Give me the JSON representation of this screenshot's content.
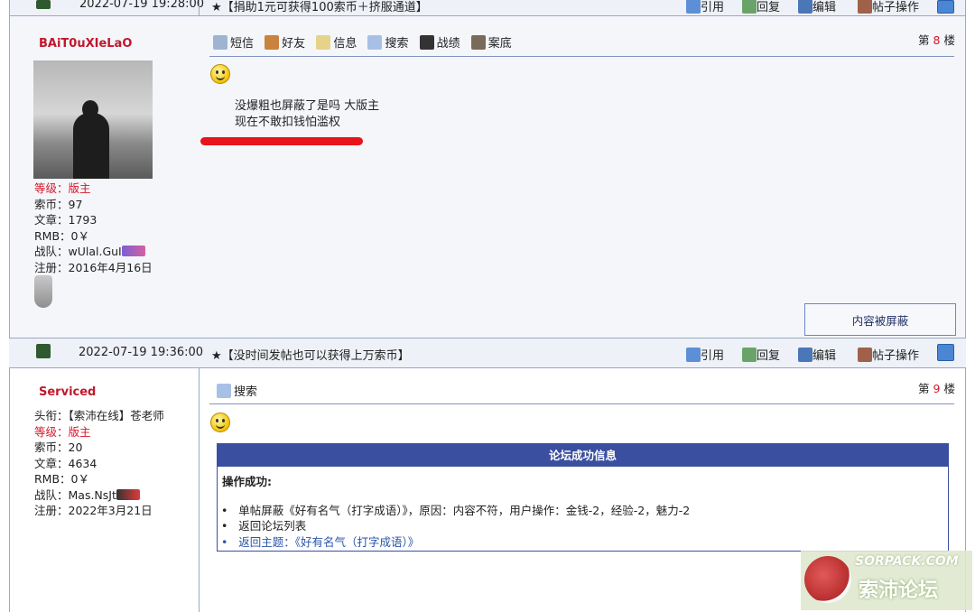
{
  "post_top": {
    "datetime": "2022-07-19 19:28:00",
    "title": "★【捐助1元可获得100索币＋挤服通道】",
    "actions": [
      "引用",
      "回复",
      "编辑",
      "帖子操作"
    ]
  },
  "post8": {
    "username": "BAiT0uXIeLaO",
    "info": {
      "level_label": "等级：",
      "level_value": "版主",
      "coins": "索币：97",
      "articles": "文章：1793",
      "rmb": "RMB：0￥",
      "team": "战队：wUlal.GuI",
      "registered": "注册：2016年4月16日"
    },
    "tools": [
      "短信",
      "好友",
      "信息",
      "搜索",
      "战绩",
      "案底"
    ],
    "floor_prefix": "第",
    "floor_num": "8",
    "floor_suffix": "楼",
    "content_line1": "没爆粗也屏蔽了是吗 大版主",
    "content_line2": "现在不敢扣钱怕滥权",
    "blocked_label": "内容被屏蔽"
  },
  "post9_bar": {
    "datetime": "2022-07-19 19:36:00",
    "title": "★【没时间发帖也可以获得上万索币】",
    "actions": [
      "引用",
      "回复",
      "编辑",
      "帖子操作"
    ]
  },
  "post9": {
    "username": "Serviced",
    "info": {
      "title_line": "头衔：【索沛在线】苍老师",
      "level_label": "等级：",
      "level_value": "版主",
      "coins": "索币：20",
      "articles": "文章：4634",
      "rmb": "RMB：0￥",
      "team": "战队：Mas.NsJt",
      "registered": "注册：2022年3月21日"
    },
    "tools": [
      "搜索"
    ],
    "floor_prefix": "第",
    "floor_num": "9",
    "floor_suffix": "楼",
    "message_box": {
      "header": "论坛成功信息",
      "status": "操作成功:",
      "items": [
        "单帖屏蔽《好有名气（打字成语）》，原因：内容不符，用户操作：金钱-2，经验-2，魅力-2",
        "返回论坛列表",
        "返回主题：《好有名气（打字成语）》"
      ]
    }
  },
  "watermark": {
    "top": "SORPACK.COM",
    "bottom": "索沛论坛"
  },
  "colors": {
    "bar_bg": "#eef1f7",
    "username": "#c0182c",
    "level_red": "#d3172b",
    "box_header": "#3b4fa0",
    "link": "#2a55a8",
    "red_mark": "#e8141c"
  }
}
